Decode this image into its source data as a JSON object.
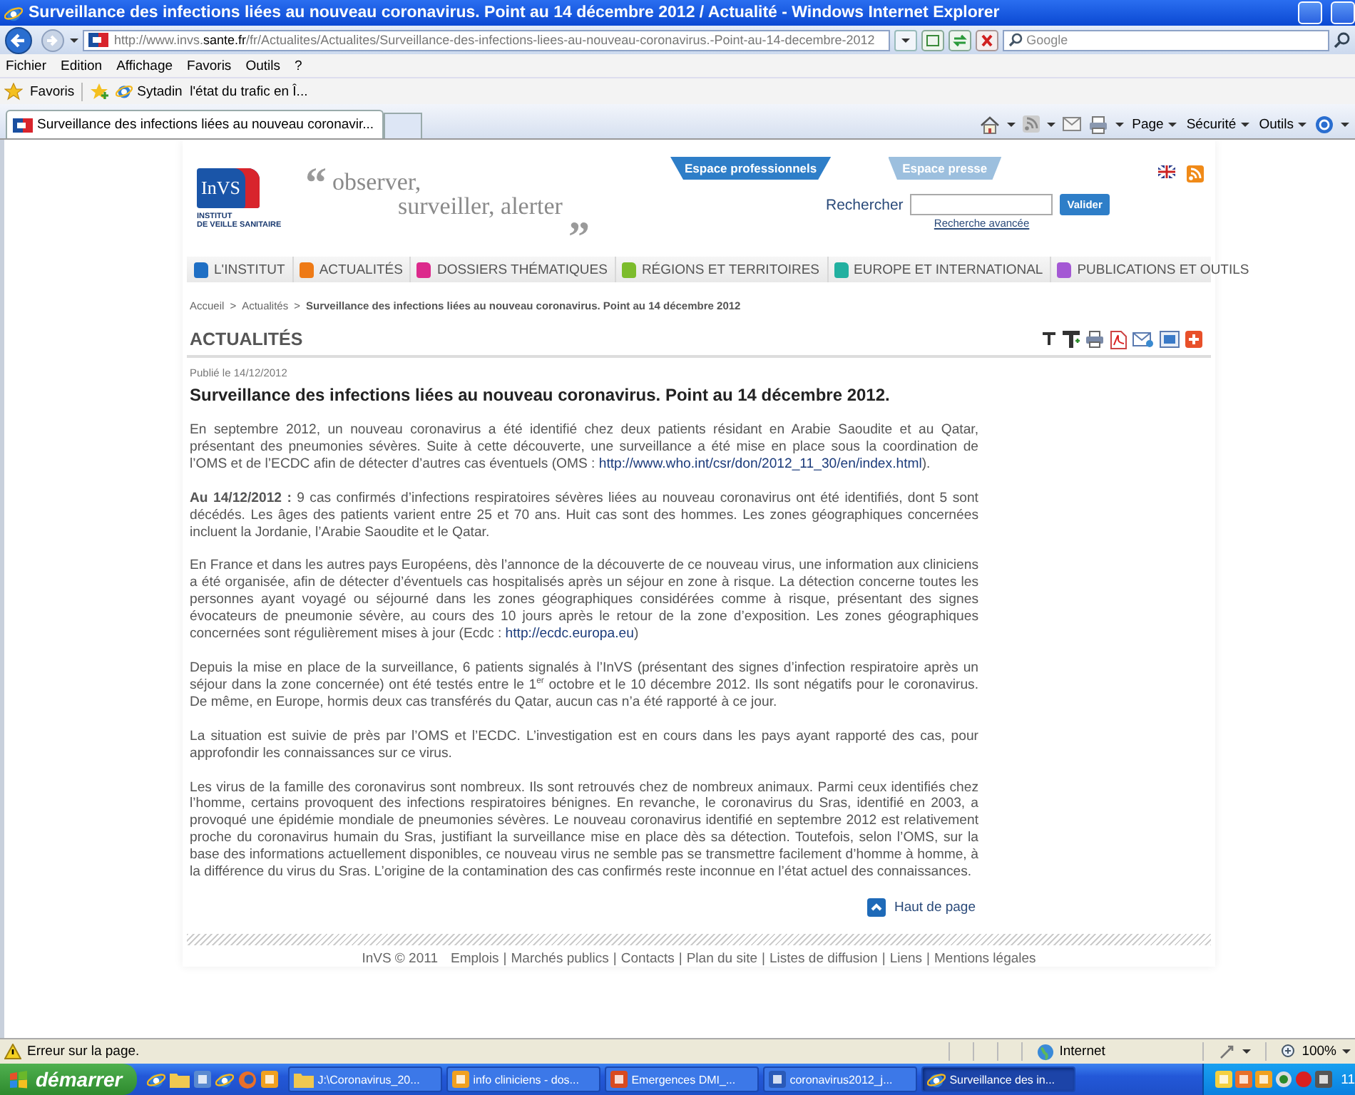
{
  "window": {
    "title": "Surveillance des infections liées au nouveau coronavirus. Point au 14 décembre 2012 / Actualité - Windows Internet Explorer"
  },
  "address_bar": {
    "url_prefix": "http://www.invs.",
    "url_domain": "sante.fr",
    "url_path": "/fr/Actualites/Actualites/Surveillance-des-infections-liees-au-nouveau-coronavirus.-Point-au-14-decembre-2012",
    "search_placeholder": "Google"
  },
  "menu_bar": [
    "Fichier",
    "Edition",
    "Affichage",
    "Favoris",
    "Outils",
    "?"
  ],
  "favorites_bar": {
    "label": "Favoris",
    "items": [
      "Sytadin  l'état du trafic en Î..."
    ]
  },
  "tabs": [
    {
      "label": "Surveillance des infections liées au nouveau coronavir...",
      "selected": true
    }
  ],
  "command_bar": [
    "Page",
    "Sécurité",
    "Outils"
  ],
  "site": {
    "logo": {
      "mark": "InVS",
      "lines": [
        "INSTITUT",
        "DE VEILLE SANITAIRE"
      ]
    },
    "slogan": {
      "quote_open": "“",
      "lines": [
        "observer,",
        "surveiller, alerter"
      ],
      "quote_close": "”"
    },
    "space_tabs": [
      {
        "label": "Espace professionnels",
        "selected": true
      },
      {
        "label": "Espace presse",
        "selected": false
      }
    ],
    "search": {
      "label": "Rechercher",
      "button": "Valider",
      "advanced_link": "Recherche avancée"
    },
    "nav": [
      {
        "label": "L'INSTITUT",
        "color": "#1f6fc4"
      },
      {
        "label": "ACTUALITÉS",
        "color": "#ee7a16"
      },
      {
        "label": "DOSSIERS THÉMATIQUES",
        "color": "#dc2a8c"
      },
      {
        "label": "RÉGIONS ET TERRITOIRES",
        "color": "#7cbc2c"
      },
      {
        "label": "EUROPE ET INTERNATIONAL",
        "color": "#22b0a0"
      },
      {
        "label": "PUBLICATIONS ET OUTILS",
        "color": "#a458d4"
      }
    ],
    "breadcrumb": {
      "separator": ">",
      "items": [
        "Accueil",
        "Actualités"
      ],
      "current": "Surveillance des infections liées au nouveau coronavirus. Point au 14 décembre 2012"
    },
    "section_title": "ACTUALITÉS",
    "published": "Publié le 14/12/2012",
    "article_title": "Surveillance des infections liées au nouveau coronavirus. Point au 14 décembre 2012.",
    "paragraphs": [
      [
        {
          "kind": "text",
          "text": "En septembre 2012, un nouveau coronavirus a été identifié chez deux patients résidant en Arabie Saoudite et au Qatar, présentant des pneumonies sévères. Suite à cette découverte, une surveillance a été mise en place sous la coordination de l’OMS et de l’ECDC afin de détecter d’autres cas éventuels (OMS : "
        },
        {
          "kind": "link",
          "text": "http://www.who.int/csr/don/2012_11_30/en/index.html"
        },
        {
          "kind": "text",
          "text": ")."
        }
      ],
      [
        {
          "kind": "text",
          "text": "**Au 14/12/2012 :** 9 cas confirmés d’infections respiratoires sévères liées au nouveau coronavirus ont été identifiés, dont 5 sont décédés. Les âges des patients varient entre 25 et 70 ans. Huit cas sont des hommes. Les zones géographiques concernées incluent la Jordanie, l’Arabie Saoudite et le Qatar."
        }
      ],
      [
        {
          "kind": "text",
          "text": "En France et dans les autres pays Européens, dès l’annonce de la découverte de ce nouveau virus, une information aux cliniciens a été organisée, afin de détecter d’éventuels cas hospitalisés après un séjour en zone à risque. La détection concerne toutes les personnes ayant voyagé ou séjourné dans les zones géographiques considérées comme à risque, présentant des signes évocateurs de pneumonie sévère, au cours des 10 jours après le retour de la zone d’exposition. Les zones géographiques concernées sont régulièrement mises à jour (Ecdc : "
        },
        {
          "kind": "link",
          "text": "http://ecdc.europa.eu"
        },
        {
          "kind": "text",
          "text": ")"
        }
      ],
      [
        {
          "kind": "text",
          "text": "Depuis la mise en place de la surveillance, 6 patients signalés à l’InVS (présentant des signes d’infection respiratoire après un séjour dans la zone concernée) ont été testés entre le 1$^{er}$ octobre et le 10 décembre 2012. Ils sont négatifs pour le coronavirus. De même, en Europe, hormis deux cas transférés du Qatar, aucun cas n’a été rapporté à ce jour."
        }
      ],
      [
        {
          "kind": "text",
          "text": "La situation est suivie de près par l’OMS et l’ECDC. L’investigation est en cours dans les pays ayant rapporté des cas, pour approfondir les connaissances sur ce virus."
        }
      ],
      [
        {
          "kind": "text",
          "text": "Les virus de la famille des coronavirus sont nombreux. Ils sont retrouvés chez de nombreux animaux. Parmi ceux identifiés chez l’homme, certains provoquent des infections respiratoires bénignes. En revanche, le coronavirus du Sras, identifié en 2003, a provoqué une épidémie mondiale de pneumonies sévères. Le nouveau coronavirus identifié en septembre 2012 est relativement proche du coronavirus humain du Sras, justifiant la surveillance mise en place dès sa détection. Toutefois, selon l’OMS, sur la base des informations actuellement disponibles, ce nouveau virus ne semble pas se transmettre facilement d’homme à homme, à la différence du virus du Sras. L’origine de la contamination des cas confirmés reste inconnue en l’état actuel des connaissances."
        }
      ]
    ],
    "back_to_top": "Haut de page",
    "footer": {
      "copyright": "InVS © 2011",
      "separator": "|",
      "links": [
        "Emplois",
        "Marchés publics",
        "Contacts",
        "Plan du site",
        "Listes de diffusion",
        "Liens",
        "Mentions légales"
      ]
    }
  },
  "status_bar": {
    "message": "Erreur sur la page.",
    "zone": "Internet",
    "zoom": "100%"
  },
  "taskbar": {
    "start": "démarrer",
    "tasks": [
      {
        "label": "J:\\Coronavirus_20...",
        "selected": false
      },
      {
        "label": "info cliniciens - dos...",
        "selected": false
      },
      {
        "label": "Emergences DMI_...",
        "selected": false
      },
      {
        "label": "coronavirus2012_j...",
        "selected": false
      },
      {
        "label": "Surveillance des in...",
        "selected": true
      }
    ],
    "clock": "11"
  }
}
